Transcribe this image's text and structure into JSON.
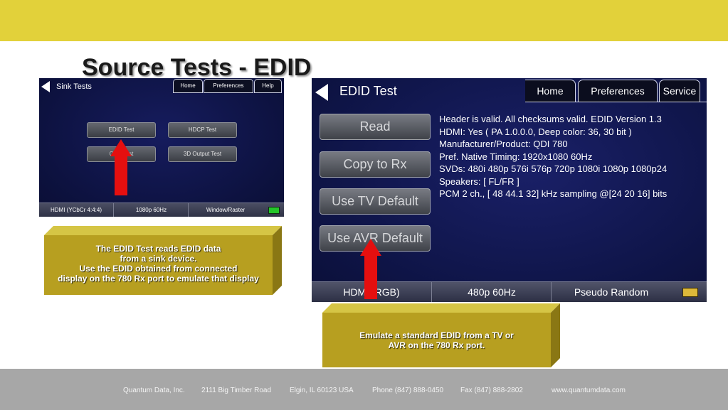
{
  "slide_title": "Source Tests - EDID",
  "sink_screen": {
    "title": "Sink Tests",
    "tabs": [
      "Home",
      "Preferences",
      "Help"
    ],
    "buttons": [
      "EDID Test",
      "HDCP Test",
      "CEC Test",
      "3D Output Test"
    ],
    "status": [
      "HDMI (YCbCr 4:4:4)",
      "1080p 60Hz",
      "Window/Raster"
    ],
    "battery_color": "#24c62a"
  },
  "edid_screen": {
    "title": "EDID Test",
    "tabs": [
      "Home",
      "Preferences",
      "Service"
    ],
    "buttons": [
      "Read",
      "Copy to Rx",
      "Use TV Default",
      "Use AVR Default"
    ],
    "info_lines": [
      "Header is valid. All checksums valid. EDID Version 1.3",
      "HDMI: Yes ( PA 1.0.0.0, Deep color: 36, 30 bit )",
      "Manufacturer/Product: QDI 780",
      "Pref. Native Timing: 1920x1080 60Hz",
      "SVDs: 480i 480p 576i 576p 720p 1080i 1080p 1080p24",
      "Speakers: [ FL/FR ]",
      "PCM 2 ch., [ 48 44.1 32] kHz sampling @[24 20 16] bits"
    ],
    "status": [
      "HDMI (RGB)",
      "480p 60Hz",
      "Pseudo Random"
    ],
    "battery_color": "#ddb93a"
  },
  "callout_left": [
    "The EDID Test reads EDID data",
    "from a sink device.",
    "Use the EDID obtained from connected",
    "display on the 780 Rx port to emulate that display"
  ],
  "callout_right": [
    "Emulate a standard EDID from a TV or",
    "AVR on the 780 Rx port."
  ],
  "footer": {
    "company": "Quantum Data, Inc.",
    "address": "2111 Big Timber Road",
    "city": "Elgin, IL 60123  USA",
    "phone": "Phone (847) 888-0450",
    "fax": "Fax (847) 888-2802",
    "web": "www.quantumdata.com"
  },
  "colors": {
    "top_bar": "#e2d13a",
    "footer_bar": "#a7a7a7",
    "arrow": "#e50f0f",
    "callout": "#b79f20"
  }
}
